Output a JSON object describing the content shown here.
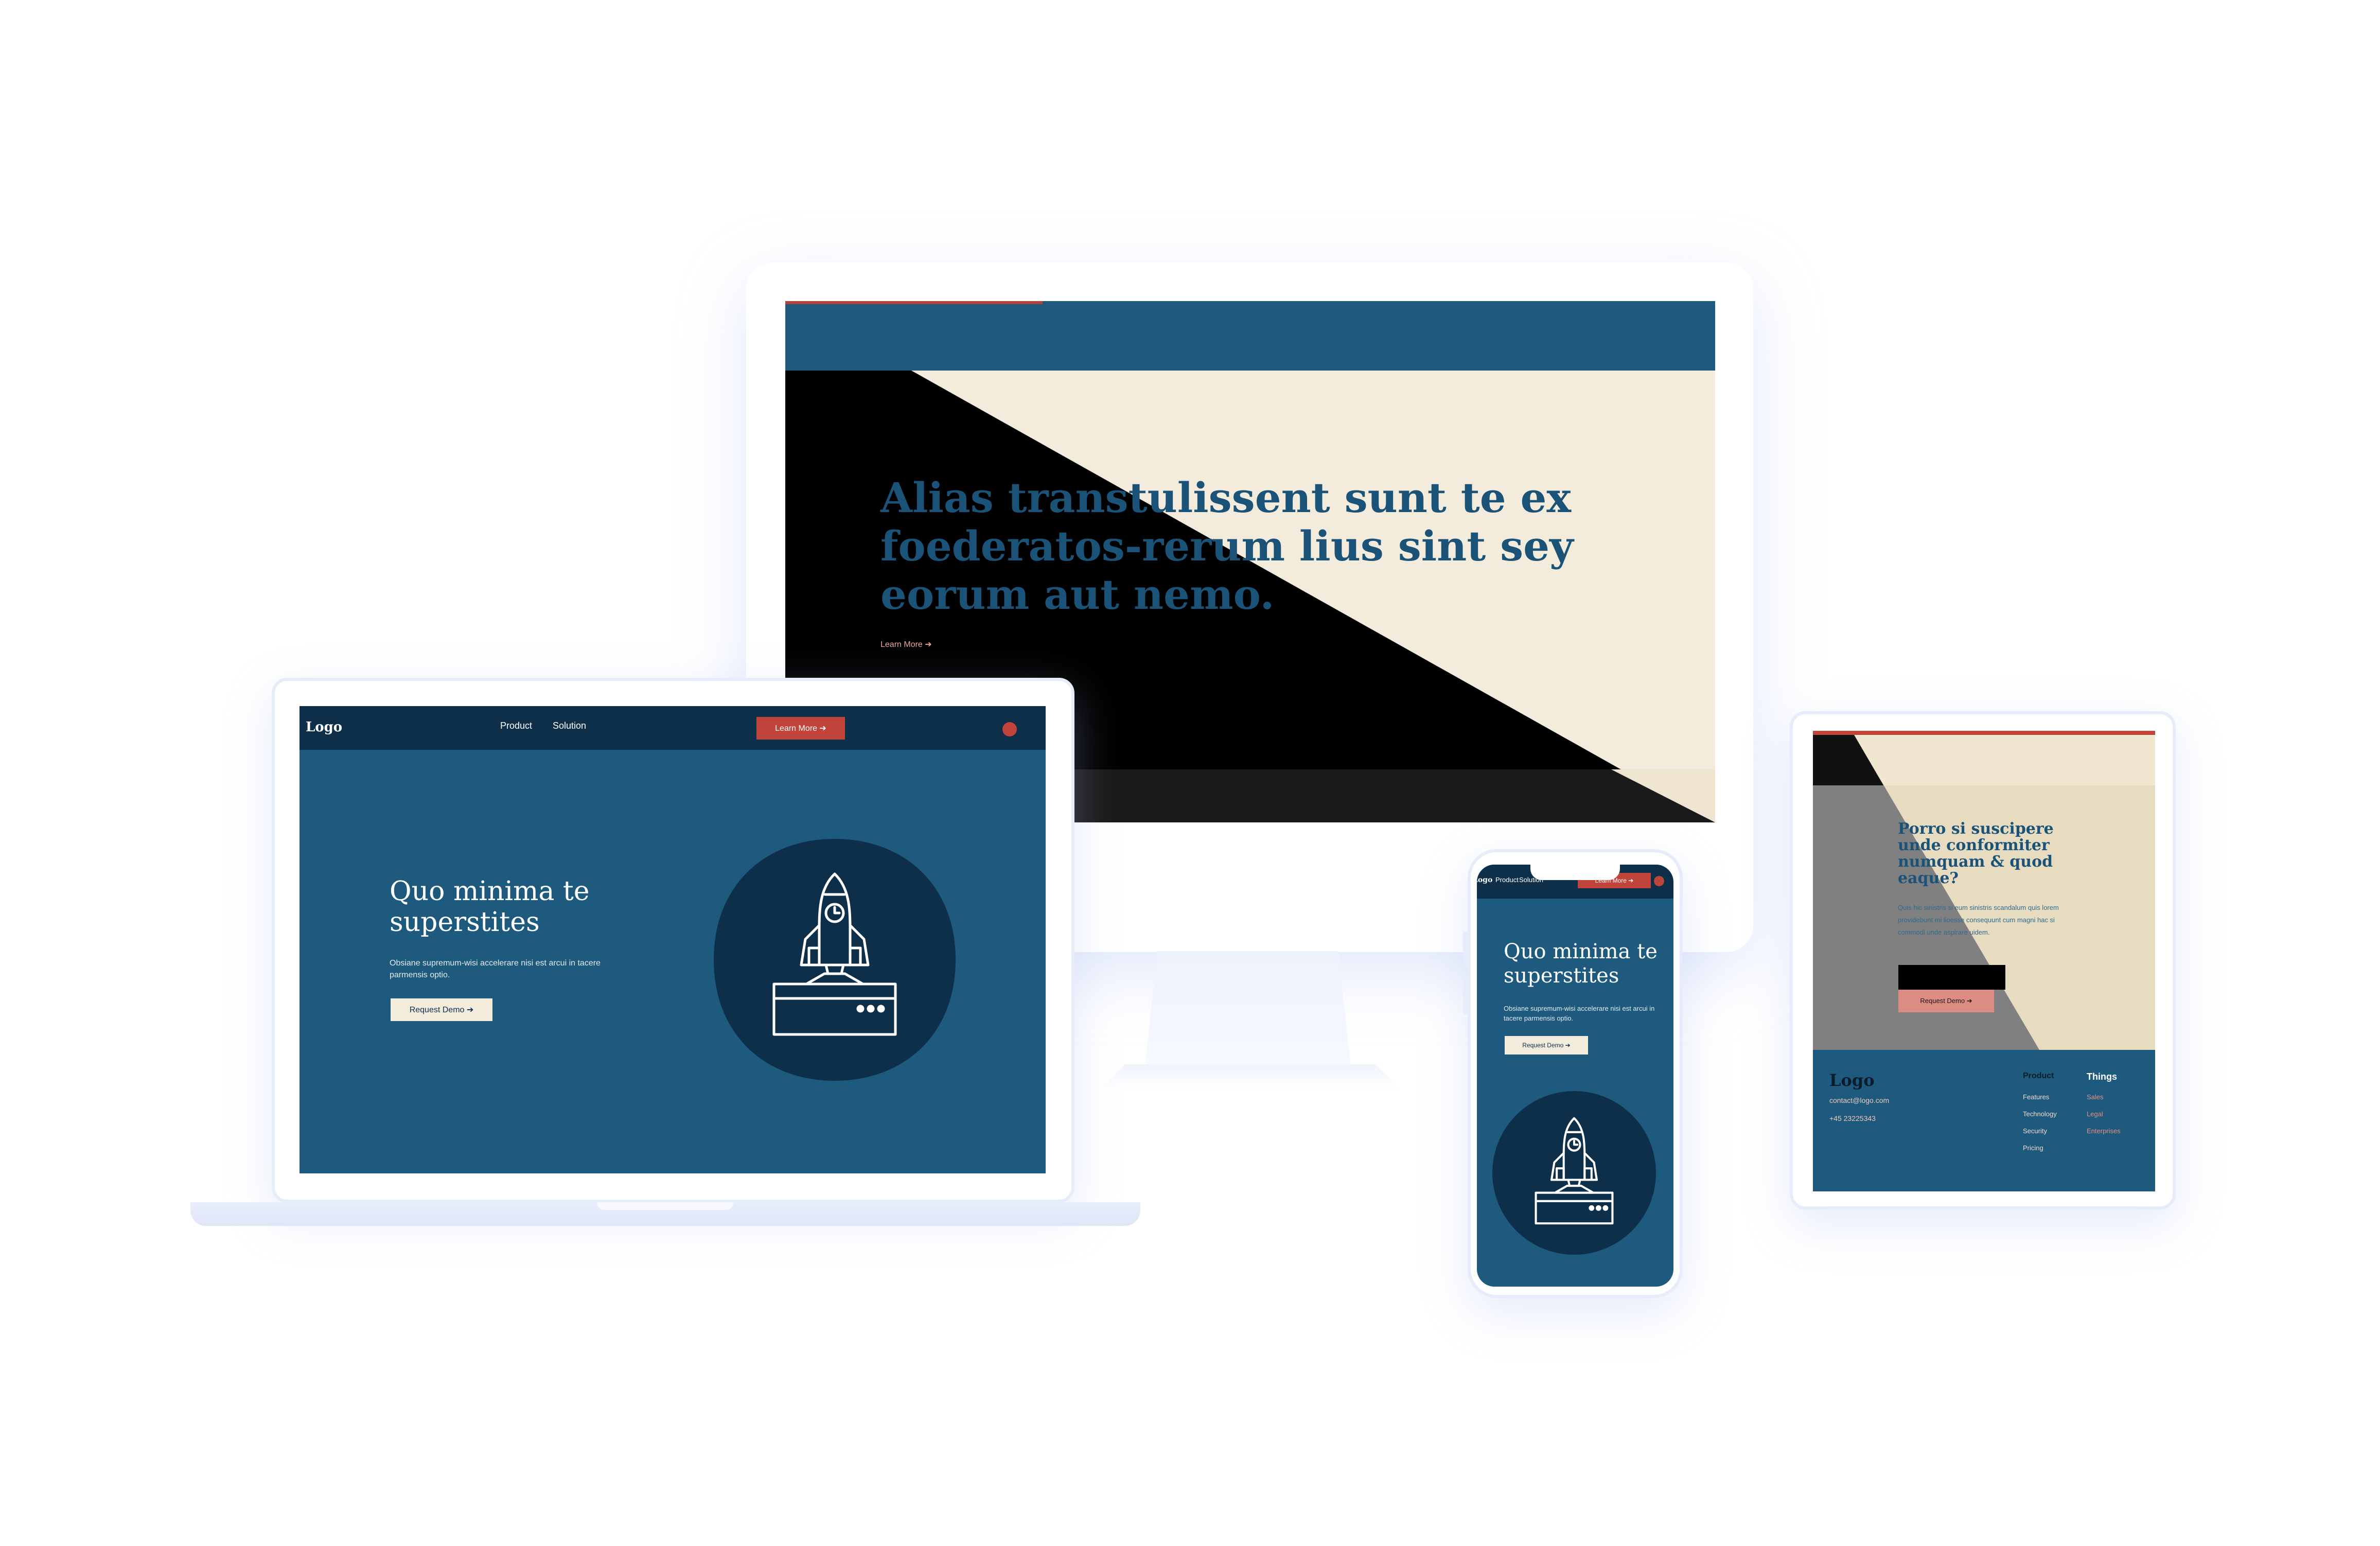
{
  "colors": {
    "navy": "#0e2f4a",
    "blue": "#1d5a7e",
    "cream": "#f3ebdc",
    "red": "#c0443a",
    "salmon": "#dd8c84",
    "black": "#000000"
  },
  "monitor": {
    "hero_title": "Alias transtulissent sunt te ex foederatos-rerum lius sint sey eorum aut nemo.",
    "learn_more": "Learn More ➔"
  },
  "laptop": {
    "logo": "Logo",
    "nav": {
      "product": "Product",
      "solution": "Solution"
    },
    "learn_more": "Learn More ➔",
    "hero_title": "Quo minima te superstites",
    "hero_desc": "Obsiane supremum-wisi accelerare nisi est arcui in tacere parmensis optio.",
    "request_demo": "Request Demo ➔",
    "illustration_icon": "rocket-launch-icon"
  },
  "phone": {
    "logo": "Logo",
    "nav": {
      "product": "Product",
      "solution": "Solution"
    },
    "learn_more": "Learn More ➔",
    "hero_title": "Quo minima te superstites",
    "hero_desc": "Obsiane supremum-wisi accelerare nisi est arcui in tacere parmensis optio.",
    "request_demo": "Request Demo ➔",
    "illustration_icon": "rocket-launch-icon"
  },
  "tablet": {
    "title": "Porro si suscipere unde conformiter numquam & quod eaque?",
    "desc": "Quis hic sinistris si eum sinistris scandalum quis lorem providebunt mi lioesse consequunt cum magni hac si commodi unde aspirare uidem.",
    "request_demo": "Request Demo ➔",
    "footer": {
      "logo": "Logo",
      "email": "contact@logo.com",
      "phone": "+45 23225343",
      "col1": {
        "heading": "Product",
        "links": [
          "Features",
          "Technology",
          "Security",
          "Pricing"
        ]
      },
      "col2": {
        "heading": "Things",
        "links": [
          "Sales",
          "Legal",
          "Enterprises"
        ]
      }
    }
  }
}
